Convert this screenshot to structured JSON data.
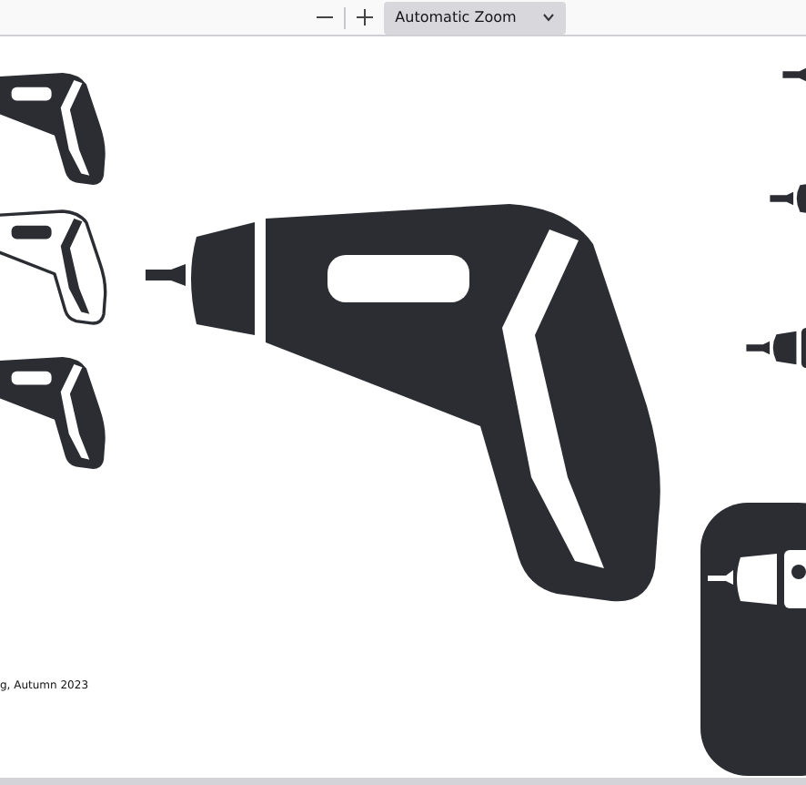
{
  "toolbar": {
    "zoom_select": {
      "value": "Automatic Zoom"
    }
  },
  "page": {
    "caption": "g, Autumn 2023"
  }
}
